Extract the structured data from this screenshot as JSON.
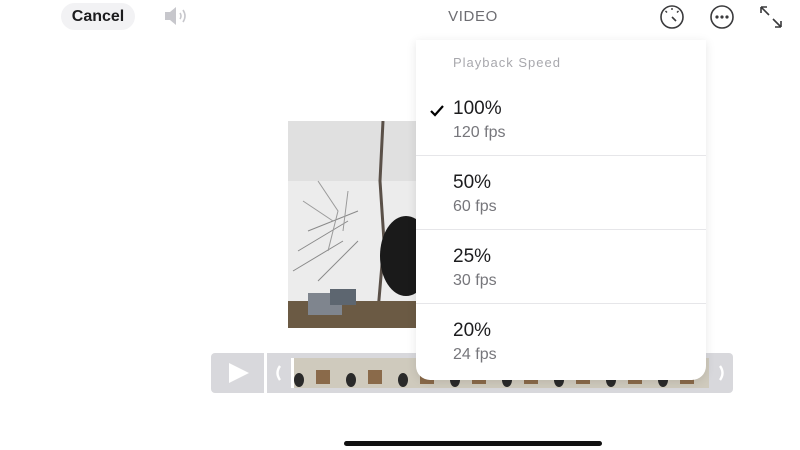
{
  "topbar": {
    "cancel_label": "Cancel",
    "title": "VIDEO",
    "icons": [
      "speaker-icon",
      "speedometer-icon",
      "more-icon",
      "expand-icon"
    ]
  },
  "playback_menu": {
    "header": "Playback Speed",
    "selected_index": 0,
    "options": [
      {
        "label": "100%",
        "sub": "120 fps"
      },
      {
        "label": "50%",
        "sub": "60 fps"
      },
      {
        "label": "25%",
        "sub": "30 fps"
      },
      {
        "label": "20%",
        "sub": "24 fps"
      }
    ]
  },
  "scrubber": {
    "play_icon": "play-icon",
    "left_handle": "chevron-left-icon",
    "right_handle": "chevron-right-icon"
  },
  "colors": {
    "background": "#ffffff",
    "scrubber_bg": "#d8d8dc",
    "text_secondary": "#76767b"
  }
}
